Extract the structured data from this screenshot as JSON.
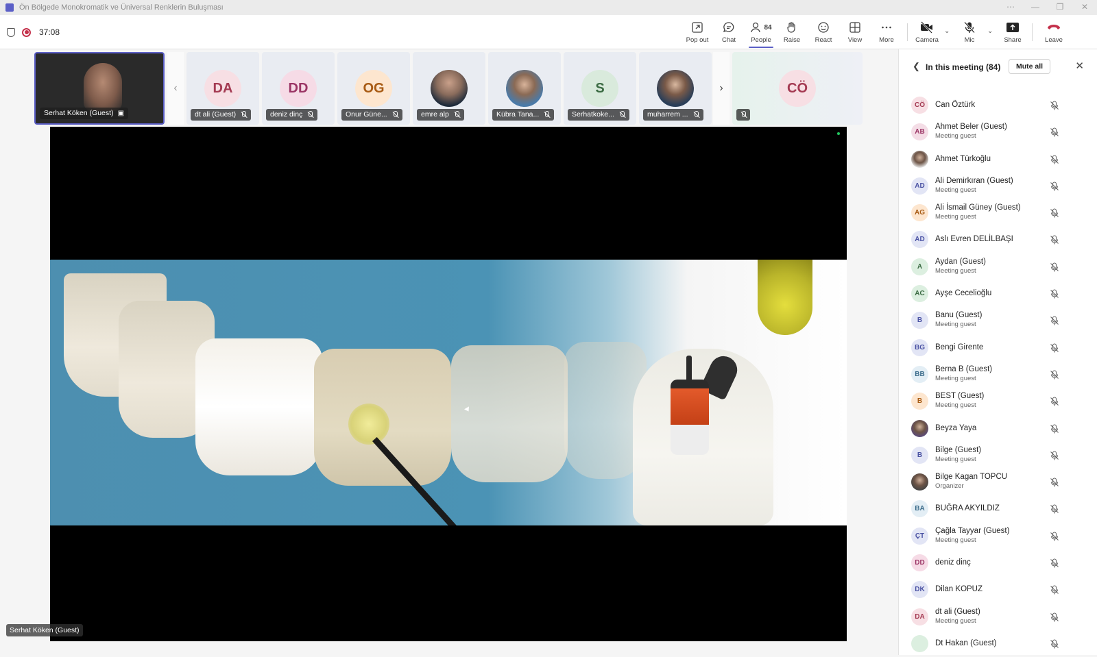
{
  "window": {
    "title": "Ön Bölgede Monokromatik ve Üniversal Renklerin Buluşması",
    "controls": [
      "⋯",
      "—",
      "❐",
      "✕"
    ]
  },
  "toolbar": {
    "timer": "37:08",
    "buttons": {
      "popout": "Pop out",
      "chat": "Chat",
      "people": "People",
      "people_count": "84",
      "raise": "Raise",
      "react": "React",
      "view": "View",
      "more": "More",
      "camera": "Camera",
      "mic": "Mic",
      "share": "Share",
      "leave": "Leave"
    },
    "accent": "#5b5fc7",
    "leave_color": "#c4314b"
  },
  "strip": {
    "main": {
      "name": "Serhat Köken (Guest)"
    },
    "tiles": [
      {
        "initials": "DA",
        "name": "dt ali (Guest)",
        "bg": "#f7dfe4",
        "fg": "#a43a52"
      },
      {
        "initials": "DD",
        "name": "deniz dinç",
        "bg": "#f6dbe6",
        "fg": "#9b3565"
      },
      {
        "initials": "OG",
        "name": "Onur Güne...",
        "bg": "#fde6cf",
        "fg": "#a85b14"
      },
      {
        "initials": "",
        "name": "emre alp",
        "bg": "#c9d3de",
        "fg": "#333333",
        "photo": true
      },
      {
        "initials": "",
        "name": "Kübra Tana...",
        "bg": "#a9c2d8",
        "fg": "#333333",
        "photo": true
      },
      {
        "initials": "S",
        "name": "Serhatkoke...",
        "bg": "#d9eadc",
        "fg": "#3b6b43"
      },
      {
        "initials": "",
        "name": "muharrem ...",
        "bg": "#b8cce0",
        "fg": "#333333",
        "photo": true
      }
    ],
    "overflow": {
      "initials": "CÖ",
      "bg": "#f7dfe4",
      "fg": "#a43a52"
    }
  },
  "stage": {
    "presenter_label": "Serhat Köken (Guest)"
  },
  "panel": {
    "title": "In this meeting (84)",
    "mute_all": "Mute all",
    "participants": [
      {
        "initials": "CÖ",
        "name": "Can Öztürk",
        "sub": "",
        "bg": "#f7dfe4",
        "fg": "#a43a52"
      },
      {
        "initials": "AB",
        "name": "Ahmet Beler (Guest)",
        "sub": "Meeting guest",
        "bg": "#f4dde6",
        "fg": "#9b3565"
      },
      {
        "initials": "",
        "name": "Ahmet Türkoğlu",
        "sub": "",
        "bg": "#e6e6e6",
        "fg": "#333333",
        "photo": true
      },
      {
        "initials": "AD",
        "name": "Ali Demirkıran (Guest)",
        "sub": "Meeting guest",
        "bg": "#e2e5f5",
        "fg": "#4a52a3"
      },
      {
        "initials": "AG",
        "name": "Ali İsmail Güney (Guest)",
        "sub": "Meeting guest",
        "bg": "#fde6cf",
        "fg": "#a85b14"
      },
      {
        "initials": "AD",
        "name": "Aslı Evren DELİLBAŞI",
        "sub": "",
        "bg": "#e2e5f5",
        "fg": "#4a52a3"
      },
      {
        "initials": "A",
        "name": "Aydan (Guest)",
        "sub": "Meeting guest",
        "bg": "#dcefe0",
        "fg": "#3b6b43"
      },
      {
        "initials": "AC",
        "name": "Ayşe Cecelioğlu",
        "sub": "",
        "bg": "#dcefe0",
        "fg": "#3b6b43"
      },
      {
        "initials": "B",
        "name": "Banu (Guest)",
        "sub": "Meeting guest",
        "bg": "#e2e5f5",
        "fg": "#4a52a3"
      },
      {
        "initials": "BG",
        "name": "Bengi Girente",
        "sub": "",
        "bg": "#e2e5f5",
        "fg": "#4a52a3"
      },
      {
        "initials": "BB",
        "name": "Berna B (Guest)",
        "sub": "Meeting guest",
        "bg": "#e3eef5",
        "fg": "#3a6b8a"
      },
      {
        "initials": "B",
        "name": "BEST (Guest)",
        "sub": "Meeting guest",
        "bg": "#fde6cf",
        "fg": "#a85b14"
      },
      {
        "initials": "",
        "name": "Beyza Yaya",
        "sub": "",
        "bg": "#5a4a7a",
        "fg": "#ffffff",
        "photo": true
      },
      {
        "initials": "B",
        "name": "Bilge (Guest)",
        "sub": "Meeting guest",
        "bg": "#e2e5f5",
        "fg": "#4a52a3"
      },
      {
        "initials": "",
        "name": "Bilge Kagan TOPCU",
        "sub": "Organizer",
        "bg": "#444444",
        "fg": "#ffffff",
        "photo": true
      },
      {
        "initials": "BA",
        "name": "BUĞRA AKYILDIZ",
        "sub": "",
        "bg": "#e3eef5",
        "fg": "#3a6b8a"
      },
      {
        "initials": "ÇT",
        "name": "Çağla Tayyar (Guest)",
        "sub": "Meeting guest",
        "bg": "#e2e5f5",
        "fg": "#4a52a3"
      },
      {
        "initials": "DD",
        "name": "deniz dinç",
        "sub": "",
        "bg": "#f6dbe6",
        "fg": "#9b3565"
      },
      {
        "initials": "DK",
        "name": "Dilan KOPUZ",
        "sub": "",
        "bg": "#e2e5f5",
        "fg": "#4a52a3"
      },
      {
        "initials": "DA",
        "name": "dt ali (Guest)",
        "sub": "Meeting guest",
        "bg": "#f7dfe4",
        "fg": "#a43a52"
      },
      {
        "initials": "",
        "name": "Dt Hakan (Guest)",
        "sub": "",
        "bg": "#dcefe0",
        "fg": "#3b6b43"
      }
    ]
  }
}
